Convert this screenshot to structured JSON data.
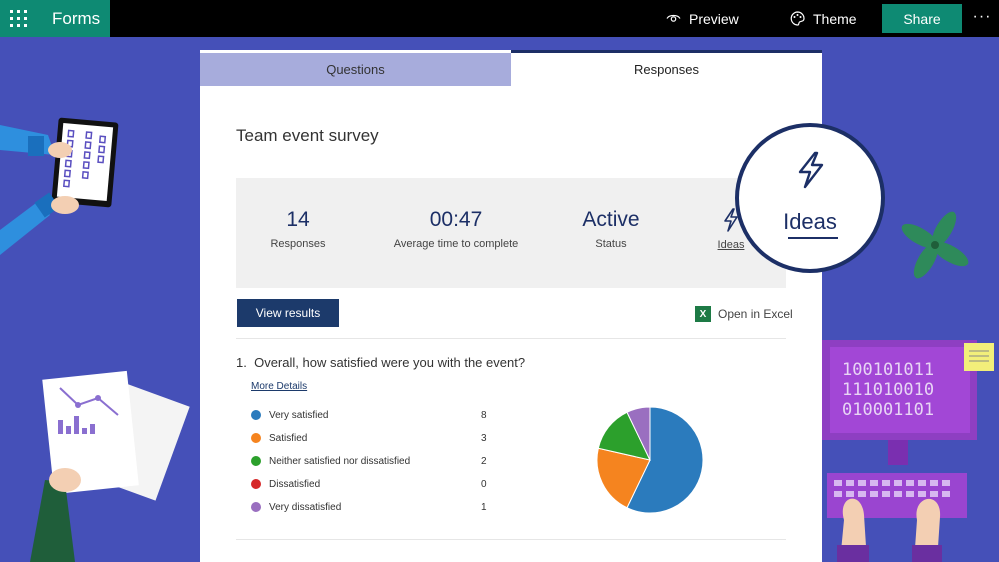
{
  "app": {
    "name": "Forms"
  },
  "topbar": {
    "preview_label": "Preview",
    "theme_label": "Theme",
    "share_label": "Share",
    "more_label": "···"
  },
  "tabs": [
    {
      "label": "Questions"
    },
    {
      "label": "Responses"
    }
  ],
  "survey": {
    "title": "Team event survey"
  },
  "stats": [
    {
      "value": "14",
      "label": "Responses"
    },
    {
      "value": "00:47",
      "label": "Average time to complete"
    },
    {
      "value": "Active",
      "label": "Status"
    },
    {
      "value": "",
      "label": "Ideas"
    }
  ],
  "actions": {
    "view_results": "View results",
    "open_excel": "Open in Excel",
    "excel_icon": "X"
  },
  "question": {
    "number": "1.",
    "text": "Overall, how satisfied were you with the event?",
    "more_details": "More Details",
    "options": [
      {
        "label": "Very satisfied",
        "count": "8",
        "color": "#2b7bbd"
      },
      {
        "label": "Satisfied",
        "count": "3",
        "color": "#f5841f"
      },
      {
        "label": "Neither satisfied nor dissatisfied",
        "count": "2",
        "color": "#2ca02c"
      },
      {
        "label": "Dissatisfied",
        "count": "0",
        "color": "#d62728"
      },
      {
        "label": "Very dissatisfied",
        "count": "1",
        "color": "#9a6fc0"
      }
    ]
  },
  "callout": {
    "label": "Ideas",
    "icon": "lightning-icon"
  },
  "illustrations": {
    "binary_lines": [
      "100101011",
      "111010010",
      "010001101"
    ]
  },
  "colors": {
    "accent": "#0e8a73",
    "navy": "#1c2f66",
    "background": "#4550b8"
  }
}
